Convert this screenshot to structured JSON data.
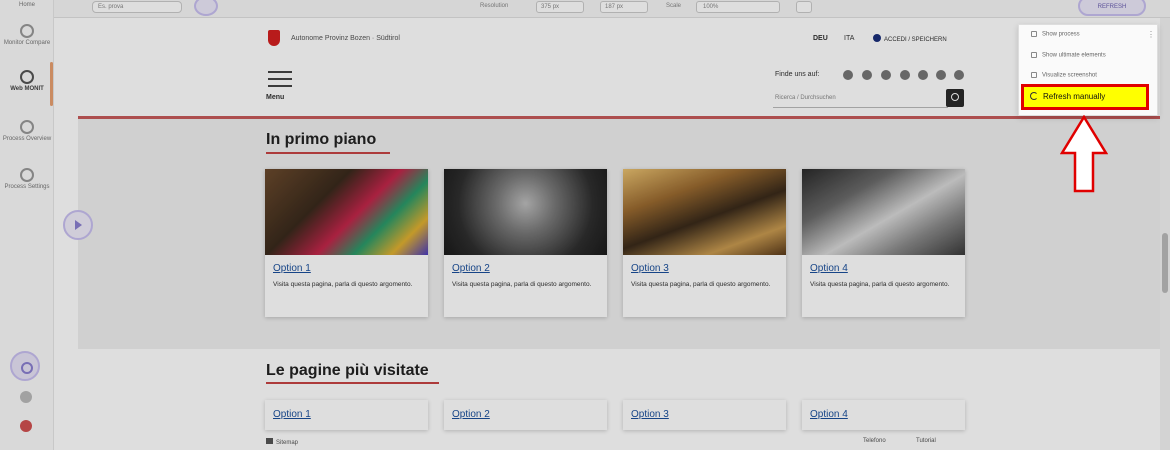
{
  "rail": {
    "items": [
      {
        "label": "Home"
      },
      {
        "label": "Monitor Compare"
      },
      {
        "label": "Web MONIT"
      },
      {
        "label": "Process Overview"
      },
      {
        "label": "Process Settings"
      }
    ]
  },
  "toolbar": {
    "mode_select": "Es. prova",
    "resolution_label": "Resolution",
    "width_value": "375",
    "height_value": "187",
    "unit": "px",
    "scale_label": "Scale",
    "scale_value": "100%",
    "refresh_button": "REFRESH"
  },
  "site": {
    "org_name": "Autonome Provinz Bozen · Südtirol",
    "lang_de": "DEU",
    "lang_it": "ITA",
    "login": "ACCEDI / SPEICHERN",
    "menu_label": "Menu",
    "follow_label": "Finde uns auf:",
    "search_placeholder": "Ricerca / Durchsuchen"
  },
  "section1": {
    "title": "In primo piano",
    "cards": [
      {
        "title": "Option 1",
        "text": "Visita questa pagina, parla di questo argomento."
      },
      {
        "title": "Option 2",
        "text": "Visita questa pagina, parla di questo argomento."
      },
      {
        "title": "Option 3",
        "text": "Visita questa pagina, parla di questo argomento."
      },
      {
        "title": "Option 4",
        "text": "Visita questa pagina, parla di questo argomento."
      }
    ]
  },
  "section2": {
    "title": "Le pagine più visitate",
    "cards": [
      {
        "title": "Option 1"
      },
      {
        "title": "Option 2"
      },
      {
        "title": "Option 3"
      },
      {
        "title": "Option 4"
      }
    ]
  },
  "footer": {
    "sitemap": "Sitemap",
    "left_link": "Telefono",
    "right_link": "Tutorial"
  },
  "menu": {
    "items": [
      {
        "label": "Show process"
      },
      {
        "label": "Show ultimate elements"
      },
      {
        "label": "Visualize screenshot"
      }
    ],
    "refresh_manually": "Refresh manually"
  },
  "colors": {
    "highlight": "#ffff00",
    "highlight_border": "#e00000",
    "link": "#1a4f9c",
    "accent_underline": "#c74444"
  }
}
